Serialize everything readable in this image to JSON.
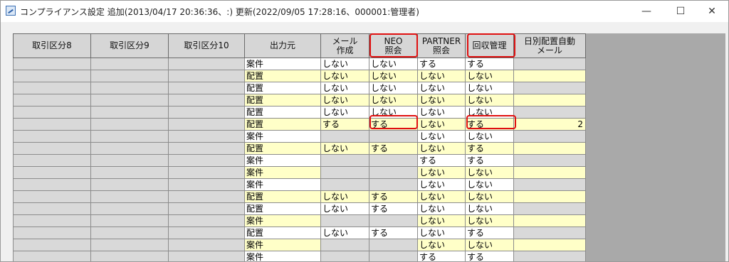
{
  "window": {
    "title": "コンプライアンス設定  追加(2013/04/17 20:36:36、:)  更新(2022/09/05 17:28:16、000001:管理者)",
    "minimize": "—",
    "maximize": "☐",
    "close": "✕"
  },
  "table": {
    "headers": [
      "取引区分8",
      "取引区分9",
      "取引区分10",
      "出力元",
      "メール\n作成",
      "NEO\n照会",
      "PARTNER\n照会",
      "回収管理",
      "日別配置自動\nメール"
    ],
    "rows": [
      [
        "",
        "",
        "",
        "案件",
        "しない",
        "しない",
        "する",
        "する",
        ""
      ],
      [
        "",
        "",
        "",
        "配置",
        "しない",
        "しない",
        "しない",
        "しない",
        ""
      ],
      [
        "",
        "",
        "",
        "配置",
        "しない",
        "しない",
        "しない",
        "しない",
        ""
      ],
      [
        "",
        "",
        "",
        "配置",
        "しない",
        "しない",
        "しない",
        "しない",
        ""
      ],
      [
        "",
        "",
        "",
        "配置",
        "しない",
        "しない",
        "しない",
        "しない",
        ""
      ],
      [
        "",
        "",
        "",
        "配置",
        "する",
        "する",
        "しない",
        "する",
        "2"
      ],
      [
        "",
        "",
        "",
        "案件",
        "",
        "",
        "しない",
        "しない",
        ""
      ],
      [
        "",
        "",
        "",
        "配置",
        "しない",
        "する",
        "しない",
        "する",
        ""
      ],
      [
        "",
        "",
        "",
        "案件",
        "",
        "",
        "する",
        "する",
        ""
      ],
      [
        "",
        "",
        "",
        "案件",
        "",
        "",
        "しない",
        "しない",
        ""
      ],
      [
        "",
        "",
        "",
        "案件",
        "",
        "",
        "しない",
        "しない",
        ""
      ],
      [
        "",
        "",
        "",
        "配置",
        "しない",
        "する",
        "しない",
        "しない",
        ""
      ],
      [
        "",
        "",
        "",
        "配置",
        "しない",
        "する",
        "しない",
        "しない",
        ""
      ],
      [
        "",
        "",
        "",
        "案件",
        "",
        "",
        "しない",
        "しない",
        ""
      ],
      [
        "",
        "",
        "",
        "配置",
        "しない",
        "する",
        "しない",
        "する",
        ""
      ],
      [
        "",
        "",
        "",
        "案件",
        "",
        "",
        "しない",
        "しない",
        ""
      ],
      [
        "",
        "",
        "",
        "案件",
        "",
        "",
        "する",
        "する",
        ""
      ]
    ]
  },
  "colors": {
    "highlight": "#e01010",
    "row_yellow": "#ffffc8",
    "row_white": "#ffffff",
    "cell_gray": "#d9d9d9"
  }
}
